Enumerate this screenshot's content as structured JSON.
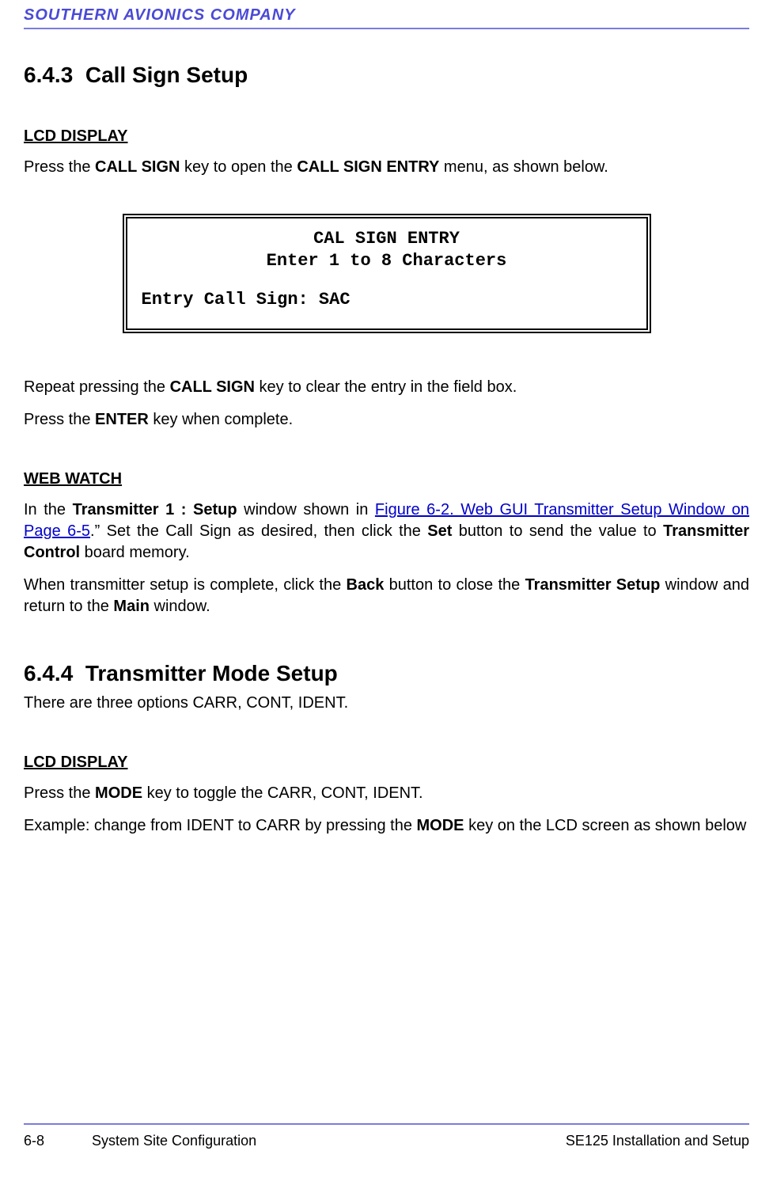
{
  "header": {
    "company": "SOUTHERN AVIONICS COMPANY"
  },
  "section1": {
    "number": "6.4.3",
    "title": "Call Sign Setup",
    "lcd_heading": "LCD DISPLAY",
    "p1_a": "Press the ",
    "p1_b1": "CALL SIGN",
    "p1_c": " key to open the ",
    "p1_b2": "CALL SIGN ENTRY",
    "p1_d": " menu, as shown below.",
    "lcd": {
      "line1": "CAL SIGN ENTRY",
      "line2": "Enter 1 to 8 Characters",
      "line3": "Entry Call Sign: SAC"
    },
    "p2_a": "Repeat pressing the ",
    "p2_b": "CALL SIGN",
    "p2_c": " key to clear the entry in the field box.",
    "p3_a": "Press the ",
    "p3_b": "ENTER",
    "p3_c": " key when complete.",
    "web_heading": "WEB WATCH",
    "p4_a": "In the ",
    "p4_b1": "Transmitter 1 : Setup",
    "p4_c": "  window shown in ",
    "p4_link": "Figure 6-2.  Web GUI Transmitter Setup Window on Page  6-5",
    "p4_d": ".”   Set the Call Sign as desired, then click the ",
    "p4_b2": "Set",
    "p4_e": " button to send the value to ",
    "p4_b3": "Transmitter Control",
    "p4_f": " board memory.",
    "p5_a": "When transmitter setup is complete, click the ",
    "p5_b1": "Back",
    "p5_b": " button to close the ",
    "p5_b2": "Transmitter Setup",
    "p5_c": " window and return to the ",
    "p5_b3": "Main",
    "p5_d": " window."
  },
  "section2": {
    "number": "6.4.4",
    "title": "Transmitter Mode Setup",
    "p1": "There are three options CARR, CONT, IDENT.",
    "lcd_heading": "LCD DISPLAY",
    "p2_a": "Press the ",
    "p2_b": "MODE",
    "p2_c": " key to toggle the CARR, CONT, IDENT.",
    "p3_a": "Example: change from IDENT to CARR by pressing the ",
    "p3_b": "MODE",
    "p3_c": " key on the LCD screen as shown below"
  },
  "footer": {
    "page": "6-8",
    "left": "System Site Configuration",
    "right": "SE125 Installation and Setup"
  }
}
